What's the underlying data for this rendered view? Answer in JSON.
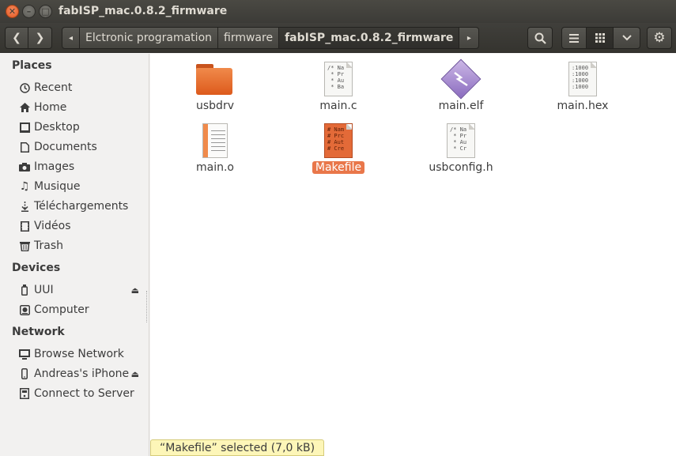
{
  "window": {
    "title": "fabISP_mac.0.8.2_firmware"
  },
  "toolbar": {
    "breadcrumbs": [
      "Elctronic programation",
      "firmware",
      "fabISP_mac.0.8.2_firmware"
    ]
  },
  "sidebar": {
    "places_header": "Places",
    "places": [
      {
        "label": "Recent",
        "icon": "clock-icon"
      },
      {
        "label": "Home",
        "icon": "home-icon"
      },
      {
        "label": "Desktop",
        "icon": "desktop-folder-icon"
      },
      {
        "label": "Documents",
        "icon": "document-icon"
      },
      {
        "label": "Images",
        "icon": "camera-icon"
      },
      {
        "label": "Musique",
        "icon": "music-icon"
      },
      {
        "label": "Téléchargements",
        "icon": "download-icon"
      },
      {
        "label": "Vidéos",
        "icon": "film-icon"
      },
      {
        "label": "Trash",
        "icon": "trash-icon"
      }
    ],
    "devices_header": "Devices",
    "devices": [
      {
        "label": "UUI",
        "icon": "usb-drive-icon"
      },
      {
        "label": "Computer",
        "icon": "harddisk-icon"
      }
    ],
    "network_header": "Network",
    "network": [
      {
        "label": "Browse Network",
        "icon": "network-icon"
      },
      {
        "label": "Andreas's iPhone",
        "icon": "phone-icon"
      },
      {
        "label": "Connect to Server",
        "icon": "server-icon"
      }
    ]
  },
  "files": [
    {
      "name": "usbdrv",
      "type": "folder"
    },
    {
      "name": "main.c",
      "type": "c-source",
      "preview": "/* Na\n * Pr\n * Au\n * Ba"
    },
    {
      "name": "main.elf",
      "type": "executable"
    },
    {
      "name": "main.hex",
      "type": "text",
      "preview": ":1000\n:1000\n:1000\n:1000"
    },
    {
      "name": "main.o",
      "type": "object"
    },
    {
      "name": "Makefile",
      "type": "makefile",
      "selected": true,
      "preview": "# Nam\n# Prc\n# Aut\n# Cre"
    },
    {
      "name": "usbconfig.h",
      "type": "c-header",
      "preview": "/* Na\n * Pr\n * Au\n * Cr"
    }
  ],
  "status": {
    "text": "“Makefile” selected (7,0 kB)"
  },
  "colors": {
    "accent": "#e9774a",
    "titlebar": "#3c3b37",
    "status_bg": "#fdf6b8"
  }
}
